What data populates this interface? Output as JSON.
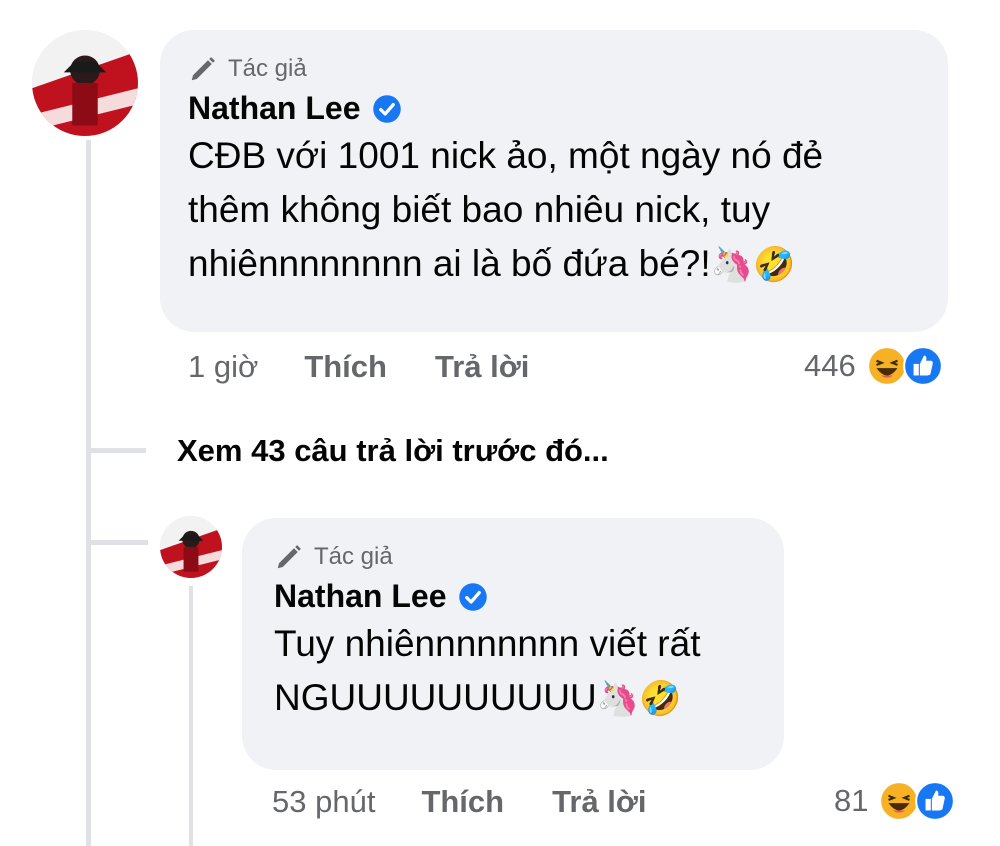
{
  "comments": [
    {
      "badge": "Tác giả",
      "author": "Nathan Lee",
      "lines": [
        "CĐB với 1001 nick ảo, một ngày nó đẻ",
        "thêm không biết bao nhiêu nick, tuy",
        "nhiênnnnnnnn ai là bố đứa bé?!"
      ],
      "emojis": "🦄🤣",
      "time": "1 giờ",
      "like_label": "Thích",
      "reply_label": "Trả lời",
      "reaction_count": "446",
      "reactions": [
        "haha-icon",
        "like-icon"
      ]
    },
    {
      "badge": "Tác giả",
      "author": "Nathan Lee",
      "lines": [
        "Tuy nhiênnnnnnnn viết rất",
        "NGUUUUUUUUUU"
      ],
      "emojis": "🦄🤣",
      "time": "53 phút",
      "like_label": "Thích",
      "reply_label": "Trả lời",
      "reaction_count": "81",
      "reactions": [
        "haha-icon",
        "like-icon"
      ]
    }
  ],
  "view_more_replies": "Xem 43 câu trả lời trước đó...",
  "colors": {
    "bubble": "#f0f2f5",
    "secondary_text": "#65676b",
    "verified_blue": "#1877f2",
    "haha_yellow": "#f7b125",
    "thread_line": "#dfe1e5"
  }
}
